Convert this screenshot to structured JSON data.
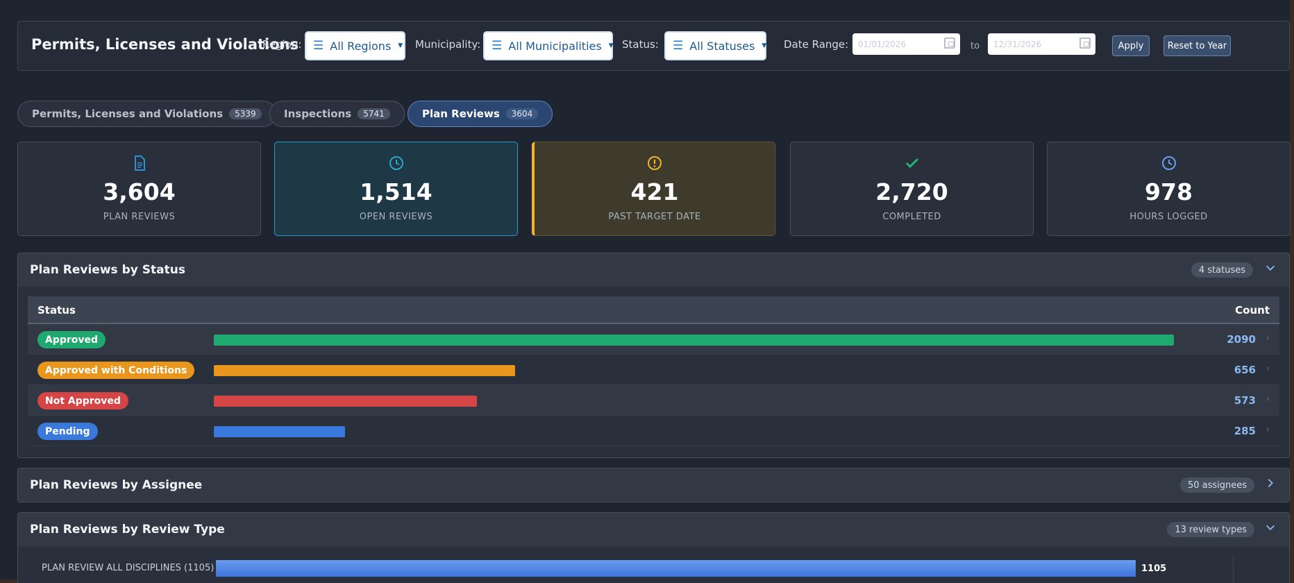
{
  "header": {
    "title": "Permits, Licenses and Violations",
    "region_label": "Region:",
    "region_value": "All Regions",
    "municipality_label": "Municipality:",
    "municipality_value": "All Municipalities",
    "status_label": "Status:",
    "status_value": "All Statuses",
    "date_range_label": "Date Range:",
    "date_from": "01/01/2026",
    "date_to": "12/31/2026",
    "to_label": "to",
    "apply_label": "Apply",
    "reset_label": "Reset to Year"
  },
  "tabs": [
    {
      "label": "Permits, Licenses and Violations",
      "count": "5339"
    },
    {
      "label": "Inspections",
      "count": "5741"
    },
    {
      "label": "Plan Reviews",
      "count": "3604"
    }
  ],
  "kpis": [
    {
      "value": "3,604",
      "label": "PLAN REVIEWS",
      "icon": "document-icon",
      "color": "#2f8fd6"
    },
    {
      "value": "1,514",
      "label": "OPEN REVIEWS",
      "icon": "clock-icon",
      "color": "#2aa7c9"
    },
    {
      "value": "421",
      "label": "PAST TARGET DATE",
      "icon": "warning-icon",
      "color": "#f2b42d"
    },
    {
      "value": "2,720",
      "label": "COMPLETED",
      "icon": "checkmark-icon",
      "color": "#22b573"
    },
    {
      "value": "978",
      "label": "HOURS LOGGED",
      "icon": "clock-icon",
      "color": "#6a9cf0"
    }
  ],
  "status_panel": {
    "title": "Plan Reviews by Status",
    "pill": "4 statuses",
    "col_status": "Status",
    "col_count": "Count",
    "rows": [
      {
        "label": "Approved",
        "count": "2090",
        "value": 2090,
        "color": "#1fa870"
      },
      {
        "label": "Approved with Conditions",
        "count": "656",
        "value": 656,
        "color": "#e8961c"
      },
      {
        "label": "Not Approved",
        "count": "573",
        "value": 573,
        "color": "#d64545"
      },
      {
        "label": "Pending",
        "count": "285",
        "value": 285,
        "color": "#3a78dc"
      }
    ]
  },
  "assignee_panel": {
    "title": "Plan Reviews by Assignee",
    "pill": "50 assignees"
  },
  "review_type_panel": {
    "title": "Plan Reviews by Review Type",
    "pill": "13 review types",
    "first_row": {
      "label": "PLAN REVIEW ALL DISCIPLINES (1105)",
      "value": "1105",
      "fraction": 1.0
    }
  }
}
